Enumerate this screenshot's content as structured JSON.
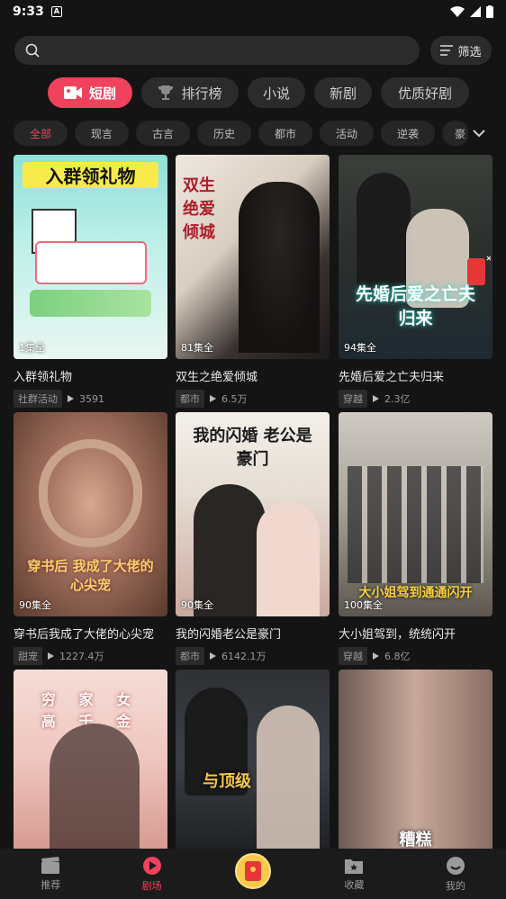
{
  "status": {
    "time": "9:33"
  },
  "search": {
    "placeholder": "",
    "filter_label": "筛选"
  },
  "main_tabs": [
    {
      "label": "短剧",
      "active": true
    },
    {
      "label": "排行榜"
    },
    {
      "label": "小说"
    },
    {
      "label": "新剧"
    },
    {
      "label": "优质好剧"
    }
  ],
  "genres": [
    "全部",
    "现言",
    "古言",
    "历史",
    "都市",
    "活动",
    "逆袭",
    "豪"
  ],
  "dramas": [
    {
      "title": "入群领礼物",
      "tag": "社群活动",
      "plays": "3591",
      "episodes": "1集全",
      "poster_text": "入群领礼物"
    },
    {
      "title": "双生之绝爱倾城",
      "tag": "都市",
      "plays": "6.5万",
      "episodes": "81集全",
      "poster_text": "双生 绝爱 倾城"
    },
    {
      "title": "先婚后爱之亡夫归来",
      "tag": "穿越",
      "plays": "2.3亿",
      "episodes": "94集全",
      "poster_text": "先婚后爱之亡夫归来"
    },
    {
      "title": "穿书后我成了大佬的心尖宠",
      "tag": "甜宠",
      "plays": "1227.4万",
      "episodes": "90集全",
      "poster_text": "穿书后 我成了大佬的 心尖宠"
    },
    {
      "title": "我的闪婚老公是豪门",
      "tag": "都市",
      "plays": "6142.1万",
      "episodes": "90集全",
      "poster_text": "我的闪婚 老公是豪门"
    },
    {
      "title": "大小姐驾到，统统闪开",
      "tag": "穿越",
      "plays": "6.8亿",
      "episodes": "100集全",
      "poster_text": "大小姐驾到通通闪开"
    },
    {
      "poster_text": "穷 家 女 高 千 金"
    },
    {
      "poster_text": "与顶级"
    },
    {
      "poster_text": "糟糕"
    }
  ],
  "nav": [
    {
      "label": "推荐"
    },
    {
      "label": "剧场",
      "active": true
    },
    {
      "label": ""
    },
    {
      "label": "收藏"
    },
    {
      "label": "我的"
    }
  ],
  "colors": {
    "accent": "#f0425d",
    "bg": "#141414",
    "chip_bg": "#262626"
  }
}
